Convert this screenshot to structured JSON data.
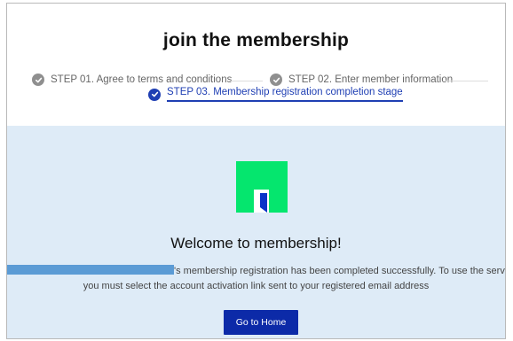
{
  "header": {
    "title": "join the membership"
  },
  "steps": [
    {
      "label": "STEP 01. Agree to terms and conditions",
      "state": "done"
    },
    {
      "label": "STEP 02. Enter member information",
      "state": "done"
    },
    {
      "label": "STEP 03. Membership registration completion stage",
      "state": "active"
    }
  ],
  "content": {
    "welcome": "Welcome to membership!",
    "message_line1": "'s membership registration has been completed successfully. To use the service normally,",
    "message_line2": "you must select the account activation link sent to your registered email address",
    "button_label": "Go to Home"
  },
  "icons": {
    "step_done": "check-circle-icon",
    "step_active": "check-circle-icon",
    "logo": "brand-logo"
  },
  "colors": {
    "accent": "#1f3fb3",
    "button": "#0c2aa8",
    "content_bg": "#deebf7",
    "logo_green": "#05e66e",
    "logo_blue": "#0a34c8",
    "redaction": "#5b9bd5"
  }
}
